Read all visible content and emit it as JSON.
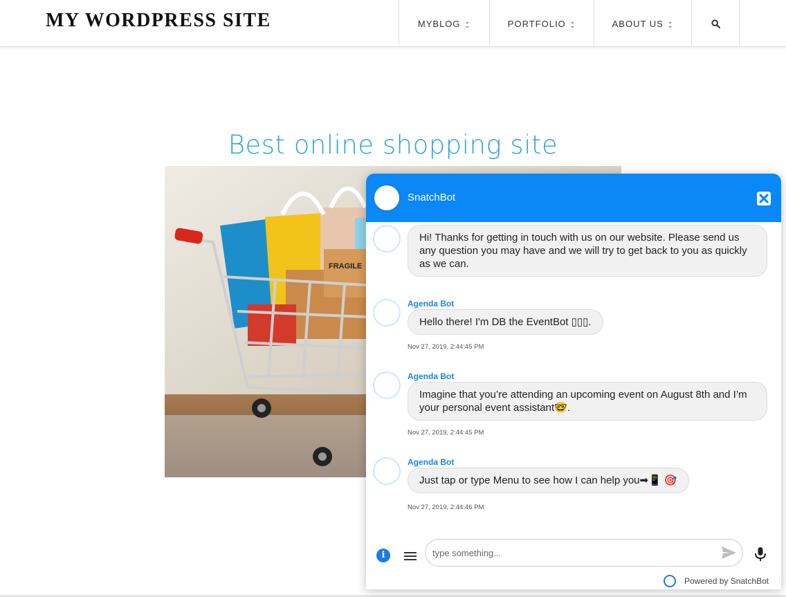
{
  "site": {
    "title": "MY WORDPRESS SITE"
  },
  "nav": {
    "items": [
      {
        "label": "MYBLOG"
      },
      {
        "label": "PORTFOLIO"
      },
      {
        "label": "ABOUT US"
      }
    ],
    "search_icon": "search-icon"
  },
  "hero": {
    "title": "Best online shopping site",
    "image_text": "FRAGILE"
  },
  "chat": {
    "title": "SnatchBot",
    "messages": [
      {
        "sender": "",
        "text": "Hi! Thanks for getting in touch with us on our website. Please send us any question you may have and we will try to get back to you as quickly as we can.",
        "time": ""
      },
      {
        "sender": "Agenda Bot",
        "text": "Hello there! I'm DB the EventBot ▯▯▯.",
        "time": "Nov 27, 2019, 2:44:45 PM"
      },
      {
        "sender": "Agenda Bot",
        "text": "Imagine that you’re attending an upcoming event on August 8th and I’m your personal event assistant🤓.",
        "time": "Nov 27, 2019, 2:44:45 PM"
      },
      {
        "sender": "Agenda Bot",
        "text": "Just tap or type Menu to see how I can help you➡📱 🎯",
        "time": "Nov 27, 2019, 2:44:46 PM"
      }
    ],
    "input_placeholder": "type something...",
    "powered_by": "Powered by SnatchBot",
    "colors": {
      "header": "#0a88f7",
      "name": "#1a85e0",
      "bubble": "#f1f1f1"
    }
  }
}
